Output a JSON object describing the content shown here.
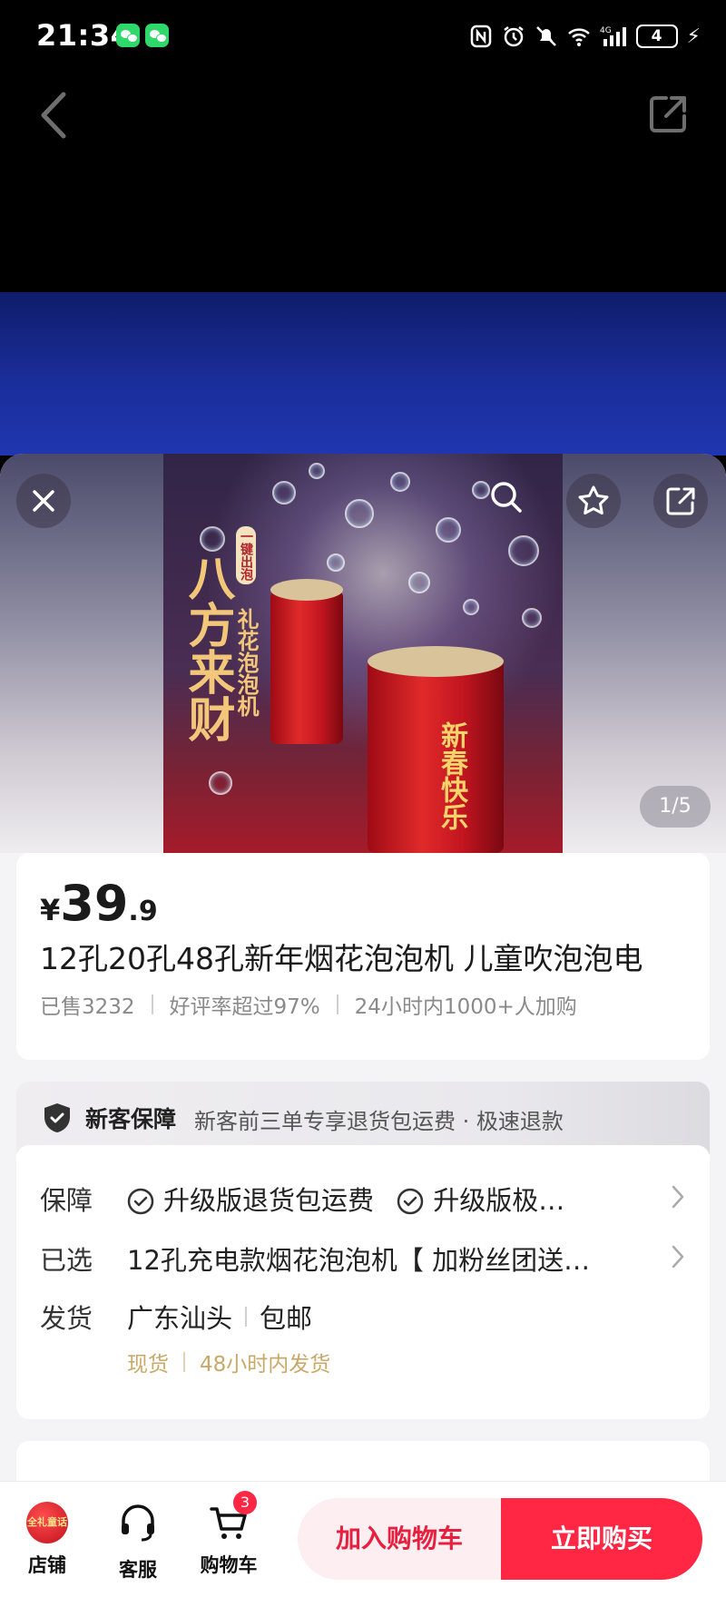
{
  "status_bar": {
    "time": "21:34",
    "network": "4G",
    "battery": "4"
  },
  "gallery": {
    "counter": "1/5",
    "image_text_main": "八方来财",
    "image_text_sub": "礼花泡泡机",
    "image_tag": "一键出泡",
    "image_text_can": "新春快乐"
  },
  "product": {
    "price_symbol": "¥",
    "price_int": "39",
    "price_dec": ".9",
    "title": "12孔20孔48孔新年烟花泡泡机 儿童吹泡泡电",
    "sold": "已售3232",
    "rating": "好评率超过97%",
    "recent": "24小时内1000+人加购"
  },
  "guarantee_banner": {
    "title": "新客保障",
    "text": "新客前三单专享退货包运费 · 极速退款"
  },
  "details": {
    "guarantee_label": "保障",
    "guarantee_item1": "升级版退货包运费",
    "guarantee_item2": "升级版极…",
    "selected_label": "已选",
    "selected_value": "12孔充电款烟花泡泡机【 加粉丝团送…",
    "shipping_label": "发货",
    "shipping_from": "广东汕头",
    "shipping_fee": "包邮",
    "stock": "现货",
    "ship_time": "48小时内发货"
  },
  "bottom_bar": {
    "shop_label": "店铺",
    "shop_logo_text": "全礼童话",
    "service_label": "客服",
    "cart_label": "购物车",
    "cart_count": "3",
    "add_cart": "加入购物车",
    "buy_now": "立即购买"
  },
  "colors": {
    "accent": "#ff2744",
    "accent_light": "#fdeef1",
    "gold": "#c9a96a"
  }
}
